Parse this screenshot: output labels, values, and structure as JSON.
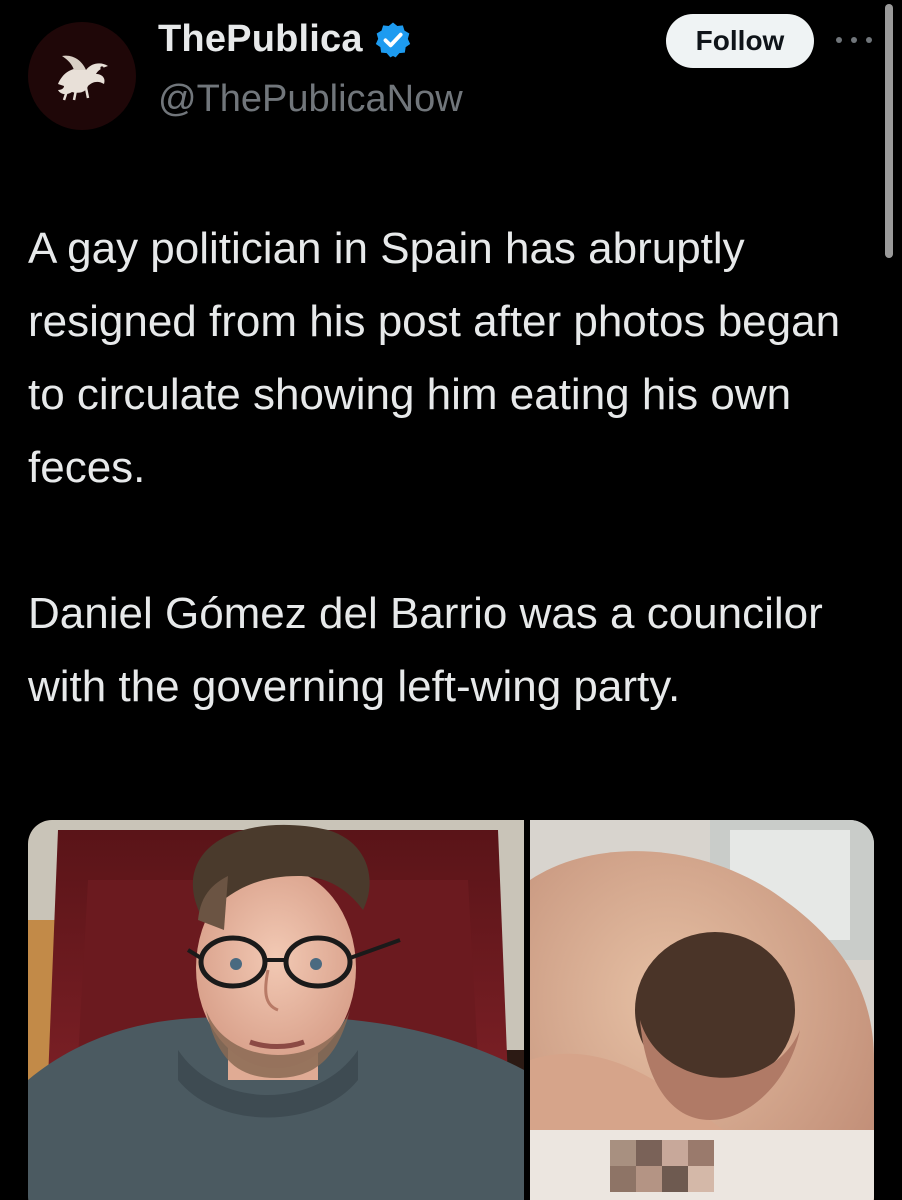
{
  "author": {
    "display_name": "ThePublica",
    "handle": "@ThePublicaNow",
    "avatar_icon": "griffin-logo-icon",
    "verified_icon": "verified-badge-icon",
    "verified_color": "#1d9bf0"
  },
  "actions": {
    "follow_label": "Follow",
    "more_icon": "more-options-icon"
  },
  "tweet": {
    "paragraph_1": "A gay politician in Spain has abruptly resigned from his post after photos began to circulate showing him eating his own feces.",
    "paragraph_2": "Daniel Gómez del Barrio was a councilor with the governing left-wing party."
  },
  "media": {
    "items": [
      {
        "kind": "photo",
        "subject": "man-with-glasses-photo"
      },
      {
        "kind": "photo",
        "subject": "pixelated-photo"
      }
    ]
  },
  "colors": {
    "background": "#000000",
    "text_primary": "#e7e9ea",
    "text_secondary": "#71767b",
    "follow_button_bg": "#eff3f4",
    "follow_button_text": "#0f1419"
  }
}
